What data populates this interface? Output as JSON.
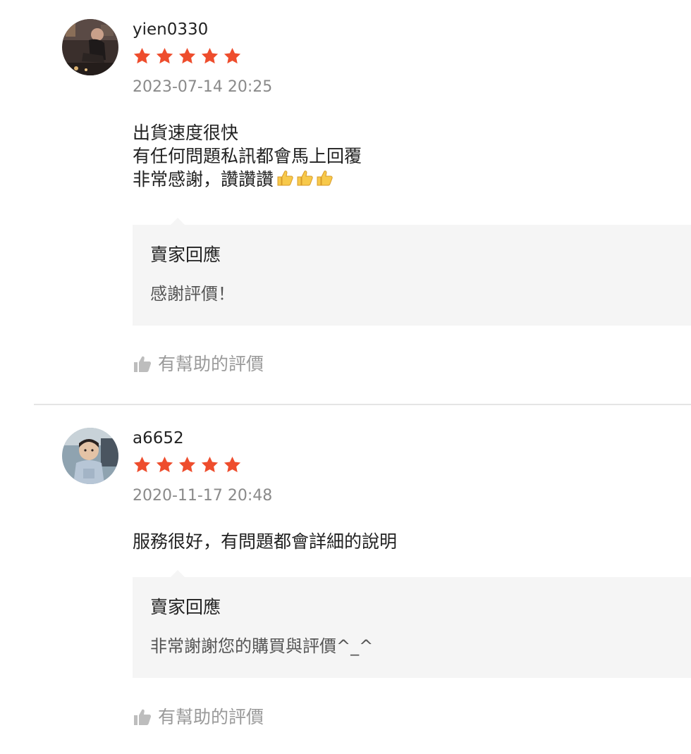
{
  "reviews": [
    {
      "username": "yien0330",
      "rating": 5,
      "timestamp": "2023-07-14 20:25",
      "content_lines": [
        "出貨速度很快",
        "有任何問題私訊都會馬上回覆",
        "非常感謝，讚讚讚"
      ],
      "seller_reply": {
        "title": "賣家回應",
        "text": "感謝評價！"
      },
      "helpful_label": "有幫助的評價"
    },
    {
      "username": "a6652",
      "rating": 5,
      "timestamp": "2020-11-17 20:48",
      "content_lines": [
        "服務很好，有問題都會詳細的說明"
      ],
      "seller_reply": {
        "title": "賣家回應",
        "text": "非常謝謝您的購買與評價^_^"
      },
      "helpful_label": "有幫助的評價"
    }
  ],
  "colors": {
    "star": "#ee4d2d",
    "reply_bg": "#f5f5f5",
    "muted_text": "#8a8a8a",
    "divider": "#e5e5e5"
  },
  "icons": {
    "rating": "star-icon",
    "helpful": "thumbs-up-icon",
    "emoji": "thumbs-up-emoji"
  }
}
